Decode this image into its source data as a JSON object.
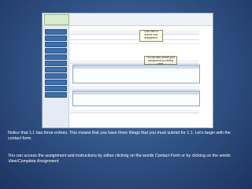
{
  "screenshot": {
    "callout_left": "Click here to access your assignment.",
    "callout_right": "You can also access your assignment by clicking here."
  },
  "caption": {
    "para1": "Notice that 1.1 has three entries.  This means that you have three things that you must submit for 1.1.  Let’s begin with the contact form.",
    "para2_a": "You can access the assignment and instructions by either clicking on the words ",
    "para2_b": "Contact Form",
    "para2_c": " or by clicking on the words ",
    "para2_d": "View/Complete Assignment"
  }
}
